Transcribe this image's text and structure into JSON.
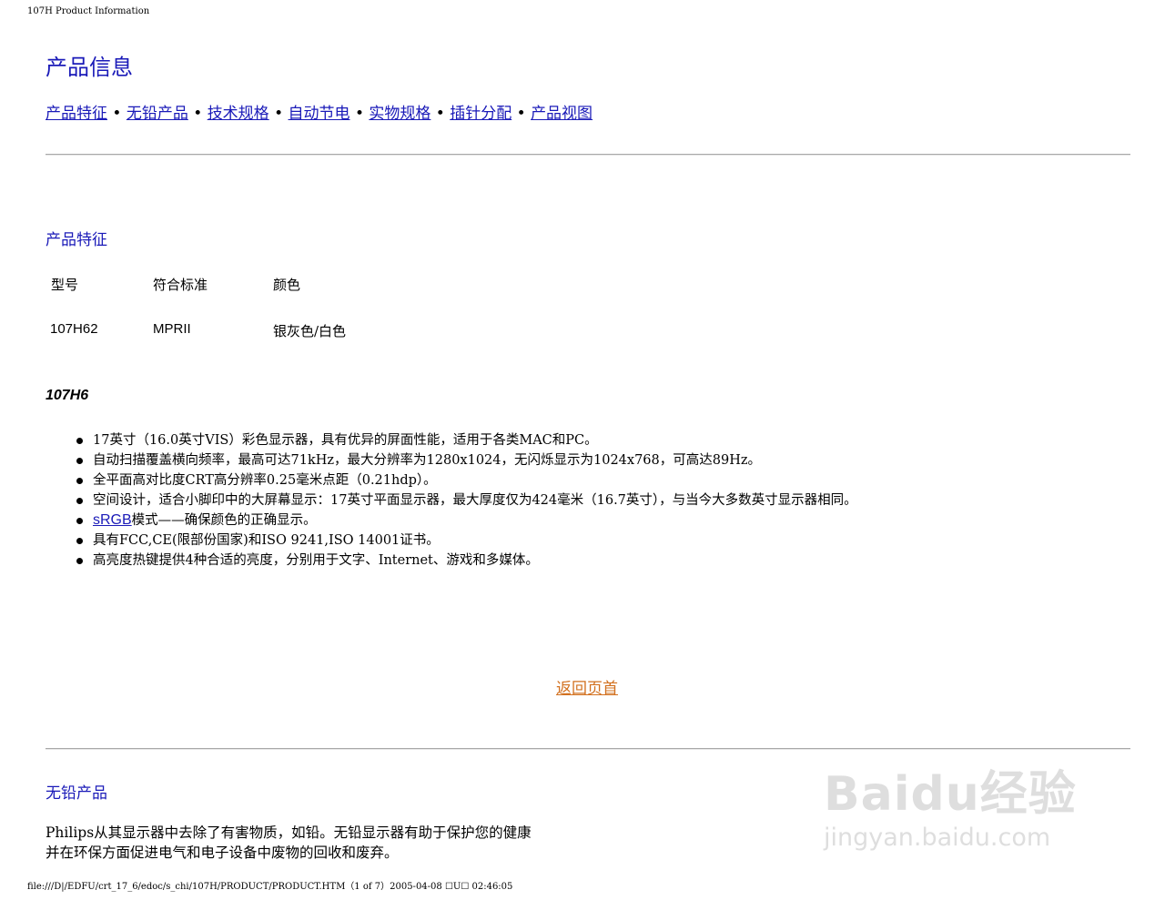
{
  "header": {
    "title": "107H Product Information"
  },
  "page_title": "产品信息",
  "nav": {
    "links": [
      "产品特征",
      "无铅产品",
      "技术规格",
      "自动节电",
      "实物规格",
      "插针分配",
      "产品视图"
    ],
    "separator": "•"
  },
  "features_section": {
    "heading": "产品特征",
    "table": {
      "headers": [
        "型号",
        "符合标准",
        "颜色"
      ],
      "row": [
        "107H62",
        "MPRII",
        "银灰色/白色"
      ]
    },
    "model_title": "107H6",
    "items": [
      "17英寸（16.0英寸VIS）彩色显示器，具有优异的屏面性能，适用于各类MAC和PC。",
      "自动扫描覆盖横向频率，最高可达71kHz，最大分辨率为1280x1024，无闪烁显示为1024x768，可高达89Hz。",
      "全平面高对比度CRT高分辨率0.25毫米点距（0.21hdp）。",
      "空间设计，适合小脚印中的大屏幕显示：17英寸平面显示器，最大厚度仅为424毫米（16.7英寸），与当今大多数英寸显示器相同。",
      "具有FCC,CE(限部份国家)和ISO 9241,ISO 14001证书。",
      "高亮度热键提供4种合适的亮度，分别用于文字、Internet、游戏和多媒体。"
    ],
    "srgb_item": {
      "link": "sRGB",
      "text": "模式——确保颜色的正确显示。"
    }
  },
  "back_to_top": "返回页首",
  "lead_free_section": {
    "heading": "无铅产品",
    "lines": [
      "Philips从其显示器中去除了有害物质，如铅。无铅显示器有助于保护您的健康",
      "并在环保方面促进电气和电子设备中废物的回收和废弃。"
    ]
  },
  "footer": {
    "text": "file:///D|/EDFU/crt_17_6/edoc/s_chi/107H/PRODUCT/PRODUCT.HTM（1 of 7）2005-04-08 ☐U☐   02:46:05"
  },
  "watermark": {
    "line1": "Baidu经验",
    "line2": "jingyan.baidu.com"
  },
  "colors": {
    "link": "#1a1ab8",
    "back_link": "#d2701e",
    "rule": "#a8a8a8"
  }
}
